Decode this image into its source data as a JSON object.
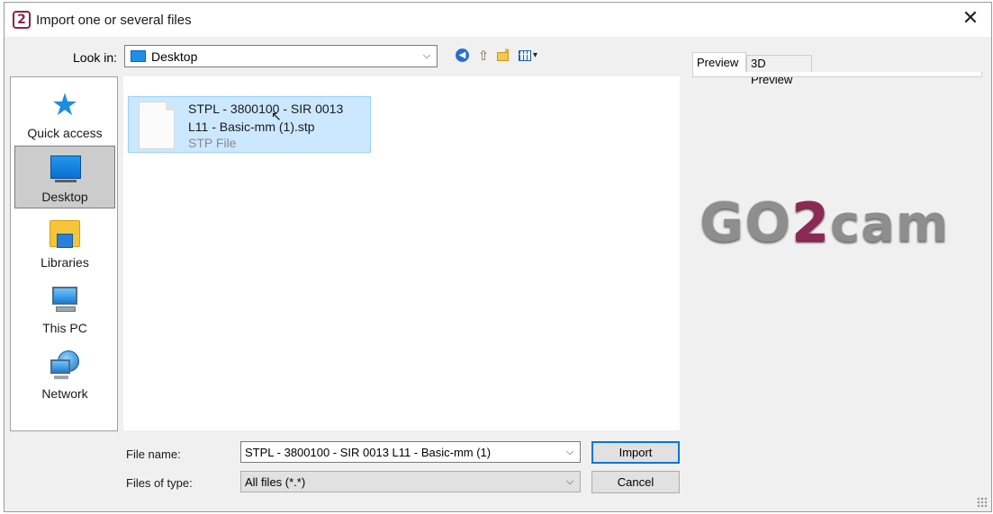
{
  "window": {
    "title": "Import one or several files",
    "app_icon_glyph": "2",
    "close_glyph": "✕"
  },
  "lookin": {
    "label": "Look in:",
    "value": "Desktop",
    "arrow": "⌵"
  },
  "toolbar": {
    "back_icon": "back-arrow-icon",
    "back_glyph": "◀",
    "up_icon": "up-folder-icon",
    "up_glyph": "⇧",
    "newfolder_icon": "new-folder-icon",
    "newfolder_glyph": "✶",
    "view_icon": "view-menu-icon",
    "view_caret": "▾"
  },
  "places": [
    {
      "label": "Quick access",
      "icon": "star-icon",
      "glyph": "★"
    },
    {
      "label": "Desktop",
      "icon": "desktop-icon",
      "selected": true
    },
    {
      "label": "Libraries",
      "icon": "libraries-icon"
    },
    {
      "label": "This PC",
      "icon": "this-pc-icon"
    },
    {
      "label": "Network",
      "icon": "network-icon"
    }
  ],
  "files": [
    {
      "name": "STPL - 3800100 - SIR 0013 L11 - Basic-mm (1).stp",
      "type": "STP File",
      "selected": true
    }
  ],
  "preview": {
    "tabs": [
      "Preview",
      "3D Preview"
    ],
    "active_tab": "Preview",
    "logo": {
      "part1": "GO",
      "part2": "2",
      "part3": "cam"
    }
  },
  "filename": {
    "label": "File name:",
    "value": "STPL - 3800100 - SIR 0013 L11 - Basic-mm (1)",
    "arrow": "⌵"
  },
  "filetype": {
    "label": "Files of type:",
    "value": "All files (*.*)",
    "arrow": "⌵"
  },
  "buttons": {
    "import": "Import",
    "cancel": "Cancel"
  },
  "colors": {
    "accent": "#0078d7",
    "selection": "#cce8ff",
    "brand": "#8a2a55"
  }
}
